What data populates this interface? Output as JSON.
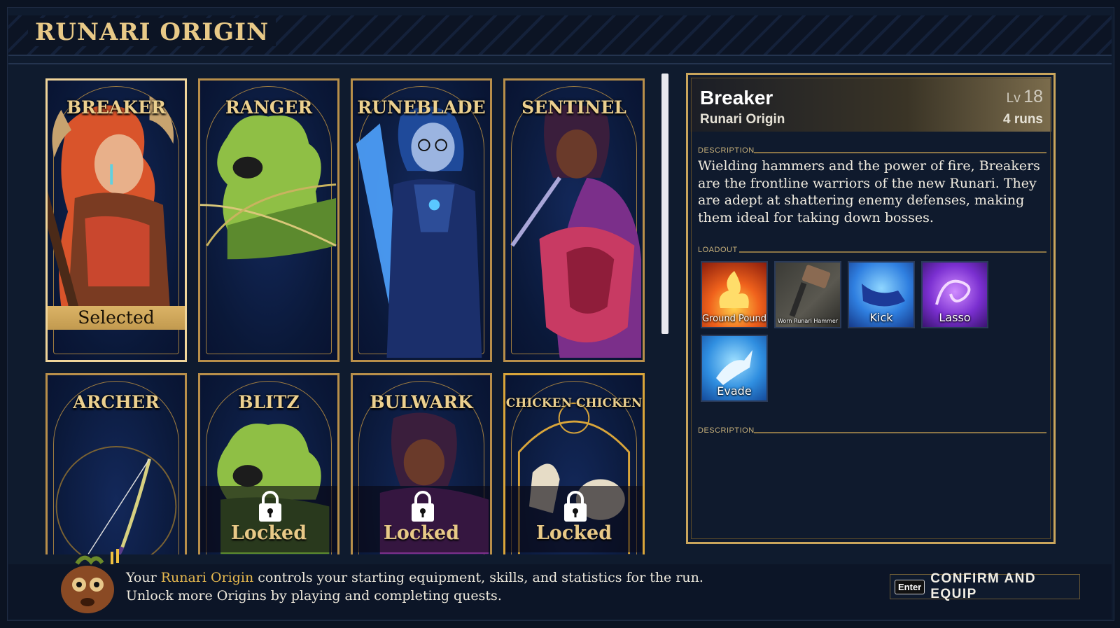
{
  "header": {
    "title": "RUNARI ORIGIN"
  },
  "origins": [
    {
      "name": "BREAKER",
      "selected_label": "Selected",
      "accent": "#d9542b"
    },
    {
      "name": "RANGER",
      "accent": "#8fbf45"
    },
    {
      "name": "RUNEBLADE",
      "accent": "#4fa3ff"
    },
    {
      "name": "SENTINEL",
      "accent": "#c83a63"
    },
    {
      "name": "ARCHER",
      "accent": "#d7d080"
    },
    {
      "name": "BLITZ",
      "locked_label": "Locked",
      "accent": "#8fbf45"
    },
    {
      "name": "BULWARK",
      "locked_label": "Locked",
      "accent": "#9b3fb0"
    },
    {
      "name": "CHICKEN CHICKEN",
      "locked_label": "Locked",
      "accent": "#e6dcc6"
    }
  ],
  "detail": {
    "name": "Breaker",
    "subtitle": "Runari Origin",
    "level_label": "Lv",
    "level": "18",
    "runs": "4 runs",
    "description_label": "DESCRIPTION",
    "description": "Wielding hammers and the power of fire, Breakers are the frontline warriors of the new Runari. They are adept at shattering enemy defenses, making them ideal for taking down bosses.",
    "loadout_label": "LOADOUT",
    "loadout": [
      {
        "name": "Ground Pound",
        "icon": "fire-icon"
      },
      {
        "name": "Worn Runari Hammer",
        "icon": "hammer-icon"
      },
      {
        "name": "Kick",
        "icon": "kick-icon"
      },
      {
        "name": "Lasso",
        "icon": "lasso-icon"
      },
      {
        "name": "Evade",
        "icon": "evade-icon"
      }
    ],
    "description2_label": "DESCRIPTION"
  },
  "footer": {
    "hint_prefix": "Your ",
    "hint_highlight": "Runari Origin",
    "hint_suffix": " controls your starting equipment, skills, and statistics for the run.",
    "hint_line2": "Unlock more Origins by playing and completing quests.",
    "confirm_key": "Enter",
    "confirm_label": "CONFIRM AND EQUIP"
  },
  "colors": {
    "gold": "#e8c987",
    "highlight": "#e6b84e",
    "panel": "#0f1a2d"
  }
}
